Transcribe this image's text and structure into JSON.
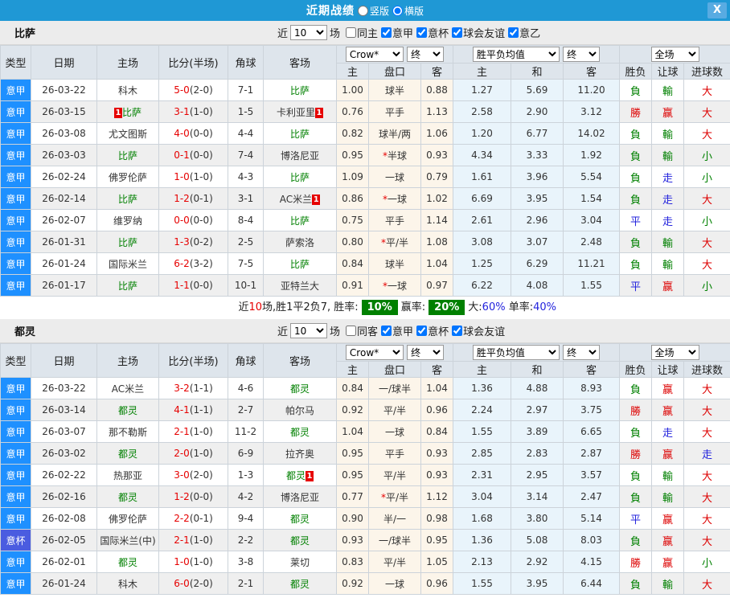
{
  "titlebar": {
    "title": "近期战绩",
    "vertical_label": "竖版",
    "horizontal_label": "横版",
    "layout_selected": "横版",
    "close": "X"
  },
  "columns": {
    "type": "类型",
    "date": "日期",
    "home": "主场",
    "score": "比分(半场)",
    "corner": "角球",
    "away": "客场",
    "sub": [
      "主",
      "盘口",
      "客",
      "主",
      "和",
      "客",
      "胜负",
      "让球",
      "进球数"
    ]
  },
  "selects": {
    "crow": "Crow*",
    "final1": "终",
    "avg": "胜平负均值",
    "final2": "终",
    "full": "全场"
  },
  "result_colors": {
    "負": "cg",
    "勝": "cr",
    "平": "cb",
    "輸": "cg",
    "赢": "cr",
    "走": "cb",
    "大": "cr",
    "小": "cg"
  },
  "colors": {
    "titlebar_blue": "#1f98d5",
    "league_blue": "#1e90ff",
    "cup_blue": "#4a5ce0",
    "win_red": "#dd0000",
    "lose_green": "#008000",
    "walk_blue": "#2323dd",
    "odds_cream": "#fcf5ea",
    "avg_lightblue": "#e9f4fb",
    "summary_badge_green": "#008000"
  },
  "sections": [
    {
      "team": "比萨",
      "filter": {
        "prefix": "近",
        "count": "10",
        "suffix": "场",
        "checks": [
          [
            "同主",
            false
          ],
          [
            "意甲",
            true
          ],
          [
            "意杯",
            true
          ],
          [
            "球会友谊",
            true
          ],
          [
            "意乙",
            true
          ]
        ]
      },
      "rows": [
        {
          "type": "意甲",
          "cup": false,
          "date": "26-03-22",
          "home": [
            "科木",
            0,
            "",
            ""
          ],
          "score": "5-0",
          "half": "(2-0)",
          "corner": "7-1",
          "away": [
            "比萨",
            1,
            "",
            ""
          ],
          "odds": [
            "1.00",
            "球半",
            "0.88"
          ],
          "avg": [
            "1.27",
            "5.69",
            "11.20"
          ],
          "res": [
            "負",
            "輸",
            "大"
          ]
        },
        {
          "type": "意甲",
          "cup": false,
          "date": "26-03-15",
          "home": [
            "比萨",
            1,
            "1",
            ""
          ],
          "score": "3-1",
          "half": "(1-0)",
          "corner": "1-5",
          "away": [
            "卡利亚里",
            0,
            "",
            "1"
          ],
          "odds": [
            "0.76",
            "平手",
            "1.13"
          ],
          "avg": [
            "2.58",
            "2.90",
            "3.12"
          ],
          "res": [
            "勝",
            "赢",
            "大"
          ]
        },
        {
          "type": "意甲",
          "cup": false,
          "date": "26-03-08",
          "home": [
            "尤文图斯",
            0,
            "",
            ""
          ],
          "score": "4-0",
          "half": "(0-0)",
          "corner": "4-4",
          "away": [
            "比萨",
            1,
            "",
            ""
          ],
          "odds": [
            "0.82",
            "球半/两",
            "1.06"
          ],
          "avg": [
            "1.20",
            "6.77",
            "14.02"
          ],
          "res": [
            "負",
            "輸",
            "大"
          ]
        },
        {
          "type": "意甲",
          "cup": false,
          "date": "26-03-03",
          "home": [
            "比萨",
            1,
            "",
            ""
          ],
          "score": "0-1",
          "half": "(0-0)",
          "corner": "7-4",
          "away": [
            "博洛尼亚",
            0,
            "",
            ""
          ],
          "odds": [
            "0.95",
            "*半球",
            "0.93"
          ],
          "avg": [
            "4.34",
            "3.33",
            "1.92"
          ],
          "res": [
            "負",
            "輸",
            "小"
          ]
        },
        {
          "type": "意甲",
          "cup": false,
          "date": "26-02-24",
          "home": [
            "佛罗伦萨",
            0,
            "",
            ""
          ],
          "score": "1-0",
          "half": "(1-0)",
          "corner": "4-3",
          "away": [
            "比萨",
            1,
            "",
            ""
          ],
          "odds": [
            "1.09",
            "一球",
            "0.79"
          ],
          "avg": [
            "1.61",
            "3.96",
            "5.54"
          ],
          "res": [
            "負",
            "走",
            "小"
          ]
        },
        {
          "type": "意甲",
          "cup": false,
          "date": "26-02-14",
          "home": [
            "比萨",
            1,
            "",
            ""
          ],
          "score": "1-2",
          "half": "(0-1)",
          "corner": "3-1",
          "away": [
            "AC米兰",
            0,
            "",
            "1"
          ],
          "odds": [
            "0.86",
            "*一球",
            "1.02"
          ],
          "avg": [
            "6.69",
            "3.95",
            "1.54"
          ],
          "res": [
            "負",
            "走",
            "大"
          ]
        },
        {
          "type": "意甲",
          "cup": false,
          "date": "26-02-07",
          "home": [
            "维罗纳",
            0,
            "",
            ""
          ],
          "score": "0-0",
          "half": "(0-0)",
          "corner": "8-4",
          "away": [
            "比萨",
            1,
            "",
            ""
          ],
          "odds": [
            "0.75",
            "平手",
            "1.14"
          ],
          "avg": [
            "2.61",
            "2.96",
            "3.04"
          ],
          "res": [
            "平",
            "走",
            "小"
          ]
        },
        {
          "type": "意甲",
          "cup": false,
          "date": "26-01-31",
          "home": [
            "比萨",
            1,
            "",
            ""
          ],
          "score": "1-3",
          "half": "(0-2)",
          "corner": "2-5",
          "away": [
            "萨索洛",
            0,
            "",
            ""
          ],
          "odds": [
            "0.80",
            "*平/半",
            "1.08"
          ],
          "avg": [
            "3.08",
            "3.07",
            "2.48"
          ],
          "res": [
            "負",
            "輸",
            "大"
          ]
        },
        {
          "type": "意甲",
          "cup": false,
          "date": "26-01-24",
          "home": [
            "国际米兰",
            0,
            "",
            ""
          ],
          "score": "6-2",
          "half": "(3-2)",
          "corner": "7-5",
          "away": [
            "比萨",
            1,
            "",
            ""
          ],
          "odds": [
            "0.84",
            "球半",
            "1.04"
          ],
          "avg": [
            "1.25",
            "6.29",
            "11.21"
          ],
          "res": [
            "負",
            "輸",
            "大"
          ]
        },
        {
          "type": "意甲",
          "cup": false,
          "date": "26-01-17",
          "home": [
            "比萨",
            1,
            "",
            ""
          ],
          "score": "1-1",
          "half": "(0-0)",
          "corner": "10-1",
          "away": [
            "亚特兰大",
            0,
            "",
            ""
          ],
          "odds": [
            "0.91",
            "*一球",
            "0.97"
          ],
          "avg": [
            "6.22",
            "4.08",
            "1.55"
          ],
          "res": [
            "平",
            "赢",
            "小"
          ]
        }
      ],
      "summary": [
        [
          "近",
          "s-k"
        ],
        [
          "10",
          "s-r"
        ],
        [
          "场,胜1平2负7, 胜率:",
          "s-k"
        ],
        [
          "10%",
          "s-badge"
        ],
        [
          "赢率:",
          "s-k"
        ],
        [
          "20%",
          "s-badge"
        ],
        [
          "大:",
          "s-k"
        ],
        [
          "60%",
          "s-b"
        ],
        [
          " 单率:",
          "s-k"
        ],
        [
          "40%",
          "s-b"
        ]
      ]
    },
    {
      "team": "都灵",
      "filter": {
        "prefix": "近",
        "count": "10",
        "suffix": "场",
        "checks": [
          [
            "同客",
            false
          ],
          [
            "意甲",
            true
          ],
          [
            "意杯",
            true
          ],
          [
            "球会友谊",
            true
          ]
        ]
      },
      "rows": [
        {
          "type": "意甲",
          "cup": false,
          "date": "26-03-22",
          "home": [
            "AC米兰",
            0,
            "",
            ""
          ],
          "score": "3-2",
          "half": "(1-1)",
          "corner": "4-6",
          "away": [
            "都灵",
            1,
            "",
            ""
          ],
          "odds": [
            "0.84",
            "一/球半",
            "1.04"
          ],
          "avg": [
            "1.36",
            "4.88",
            "8.93"
          ],
          "res": [
            "負",
            "赢",
            "大"
          ]
        },
        {
          "type": "意甲",
          "cup": false,
          "date": "26-03-14",
          "home": [
            "都灵",
            1,
            "",
            ""
          ],
          "score": "4-1",
          "half": "(1-1)",
          "corner": "2-7",
          "away": [
            "帕尔马",
            0,
            "",
            ""
          ],
          "odds": [
            "0.92",
            "平/半",
            "0.96"
          ],
          "avg": [
            "2.24",
            "2.97",
            "3.75"
          ],
          "res": [
            "勝",
            "赢",
            "大"
          ]
        },
        {
          "type": "意甲",
          "cup": false,
          "date": "26-03-07",
          "home": [
            "那不勒斯",
            0,
            "",
            ""
          ],
          "score": "2-1",
          "half": "(1-0)",
          "corner": "11-2",
          "away": [
            "都灵",
            1,
            "",
            ""
          ],
          "odds": [
            "1.04",
            "一球",
            "0.84"
          ],
          "avg": [
            "1.55",
            "3.89",
            "6.65"
          ],
          "res": [
            "負",
            "走",
            "大"
          ]
        },
        {
          "type": "意甲",
          "cup": false,
          "date": "26-03-02",
          "home": [
            "都灵",
            1,
            "",
            ""
          ],
          "score": "2-0",
          "half": "(1-0)",
          "corner": "6-9",
          "away": [
            "拉齐奥",
            0,
            "",
            ""
          ],
          "odds": [
            "0.95",
            "平手",
            "0.93"
          ],
          "avg": [
            "2.85",
            "2.83",
            "2.87"
          ],
          "res": [
            "勝",
            "赢",
            "走"
          ]
        },
        {
          "type": "意甲",
          "cup": false,
          "date": "26-02-22",
          "home": [
            "热那亚",
            0,
            "",
            ""
          ],
          "score": "3-0",
          "half": "(2-0)",
          "corner": "1-3",
          "away": [
            "都灵",
            1,
            "",
            "1"
          ],
          "odds": [
            "0.95",
            "平/半",
            "0.93"
          ],
          "avg": [
            "2.31",
            "2.95",
            "3.57"
          ],
          "res": [
            "負",
            "輸",
            "大"
          ]
        },
        {
          "type": "意甲",
          "cup": false,
          "date": "26-02-16",
          "home": [
            "都灵",
            1,
            "",
            ""
          ],
          "score": "1-2",
          "half": "(0-0)",
          "corner": "4-2",
          "away": [
            "博洛尼亚",
            0,
            "",
            ""
          ],
          "odds": [
            "0.77",
            "*平/半",
            "1.12"
          ],
          "avg": [
            "3.04",
            "3.14",
            "2.47"
          ],
          "res": [
            "負",
            "輸",
            "大"
          ]
        },
        {
          "type": "意甲",
          "cup": false,
          "date": "26-02-08",
          "home": [
            "佛罗伦萨",
            0,
            "",
            ""
          ],
          "score": "2-2",
          "half": "(0-1)",
          "corner": "9-4",
          "away": [
            "都灵",
            1,
            "",
            ""
          ],
          "odds": [
            "0.90",
            "半/一",
            "0.98"
          ],
          "avg": [
            "1.68",
            "3.80",
            "5.14"
          ],
          "res": [
            "平",
            "赢",
            "大"
          ]
        },
        {
          "type": "意杯",
          "cup": true,
          "date": "26-02-05",
          "home": [
            "国际米兰(中)",
            0,
            "",
            ""
          ],
          "score": "2-1",
          "half": "(1-0)",
          "corner": "2-2",
          "away": [
            "都灵",
            1,
            "",
            ""
          ],
          "odds": [
            "0.93",
            "一/球半",
            "0.95"
          ],
          "avg": [
            "1.36",
            "5.08",
            "8.03"
          ],
          "res": [
            "負",
            "赢",
            "大"
          ]
        },
        {
          "type": "意甲",
          "cup": false,
          "date": "26-02-01",
          "home": [
            "都灵",
            1,
            "",
            ""
          ],
          "score": "1-0",
          "half": "(1-0)",
          "corner": "3-8",
          "away": [
            "莱切",
            0,
            "",
            ""
          ],
          "odds": [
            "0.83",
            "平/半",
            "1.05"
          ],
          "avg": [
            "2.13",
            "2.92",
            "4.15"
          ],
          "res": [
            "勝",
            "赢",
            "小"
          ]
        },
        {
          "type": "意甲",
          "cup": false,
          "date": "26-01-24",
          "home": [
            "科木",
            0,
            "",
            ""
          ],
          "score": "6-0",
          "half": "(2-0)",
          "corner": "2-1",
          "away": [
            "都灵",
            1,
            "",
            ""
          ],
          "odds": [
            "0.92",
            "一球",
            "0.96"
          ],
          "avg": [
            "1.55",
            "3.95",
            "6.44"
          ],
          "res": [
            "負",
            "輸",
            "大"
          ]
        }
      ],
      "summary": null
    }
  ]
}
